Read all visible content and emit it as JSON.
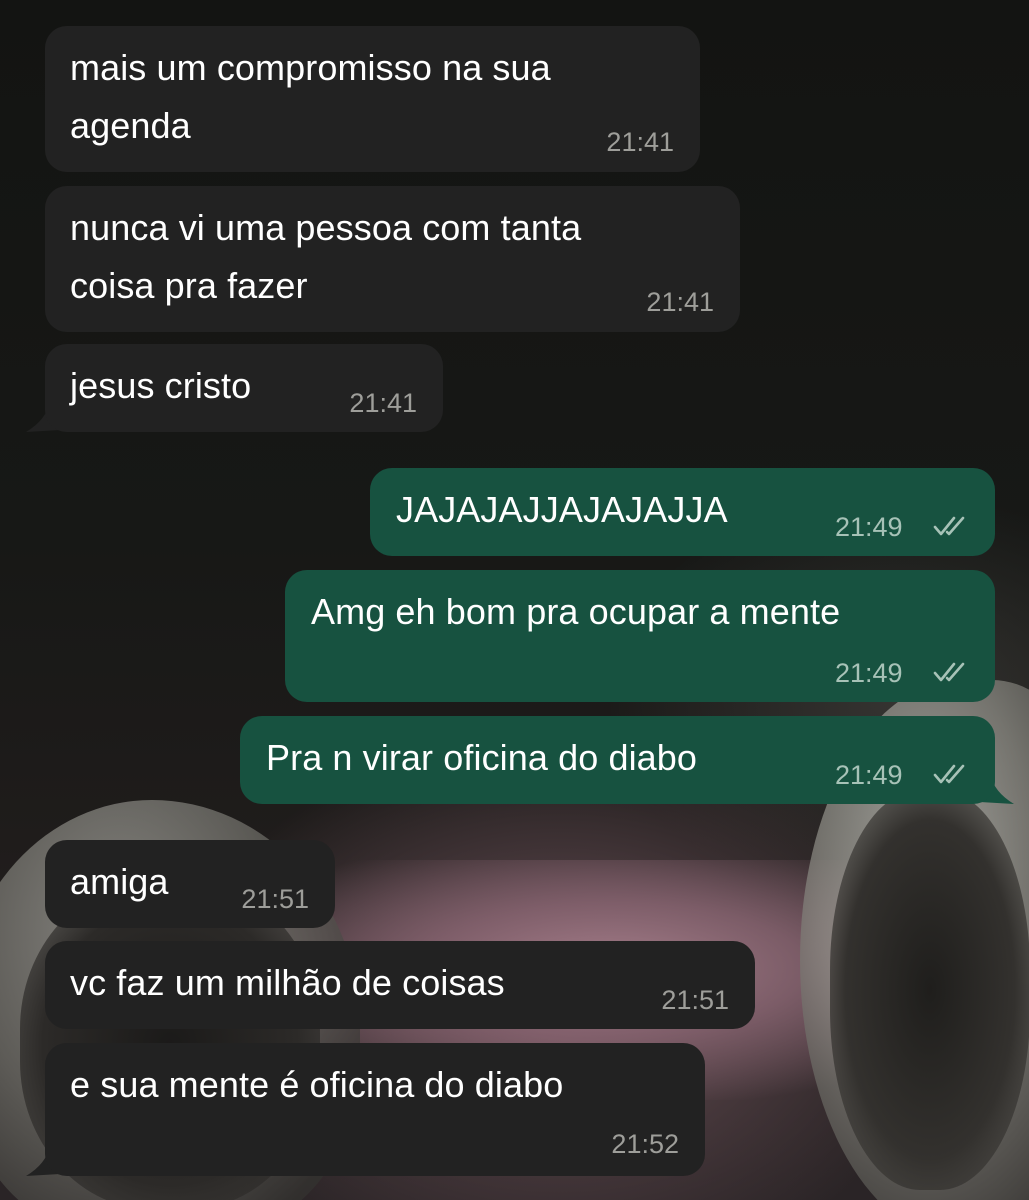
{
  "messages": [
    {
      "direction": "incoming",
      "text": "mais um compromisso na sua agenda",
      "lines": [
        "mais um compromisso na sua",
        "agenda"
      ],
      "time": "21:41"
    },
    {
      "direction": "incoming",
      "text": "nunca vi uma pessoa com tanta coisa pra fazer",
      "lines": [
        "nunca vi uma pessoa com tanta",
        "coisa pra fazer"
      ],
      "time": "21:41"
    },
    {
      "direction": "incoming",
      "text": "jesus cristo",
      "lines": [
        "jesus cristo"
      ],
      "time": "21:41"
    },
    {
      "direction": "outgoing",
      "text": "JAJAJAJJAJAJAJJA",
      "lines": [
        "JAJAJAJJAJAJAJJA"
      ],
      "time": "21:49",
      "status": "read"
    },
    {
      "direction": "outgoing",
      "text": "Amg eh bom pra ocupar a mente",
      "lines": [
        "Amg eh bom pra ocupar a mente"
      ],
      "time": "21:49",
      "status": "read"
    },
    {
      "direction": "outgoing",
      "text": "Pra n virar oficina do diabo",
      "lines": [
        "Pra n virar oficina do diabo"
      ],
      "time": "21:49",
      "status": "read"
    },
    {
      "direction": "incoming",
      "text": "amiga",
      "lines": [
        "amiga"
      ],
      "time": "21:51"
    },
    {
      "direction": "incoming",
      "text": "vc faz um milhão de coisas",
      "lines": [
        "vc faz um milhão de coisas"
      ],
      "time": "21:51"
    },
    {
      "direction": "incoming",
      "text": "e sua mente é oficina do diabo",
      "lines": [
        "e sua mente é oficina do diabo"
      ],
      "time": "21:52"
    }
  ],
  "icons": {
    "read_receipt": "double-check-icon"
  },
  "colors": {
    "incoming_bubble": "#222222",
    "outgoing_bubble": "#175240",
    "text": "#ffffff",
    "timestamp_incoming": "#9e9e9a",
    "timestamp_outgoing": "#a7c2b7"
  }
}
